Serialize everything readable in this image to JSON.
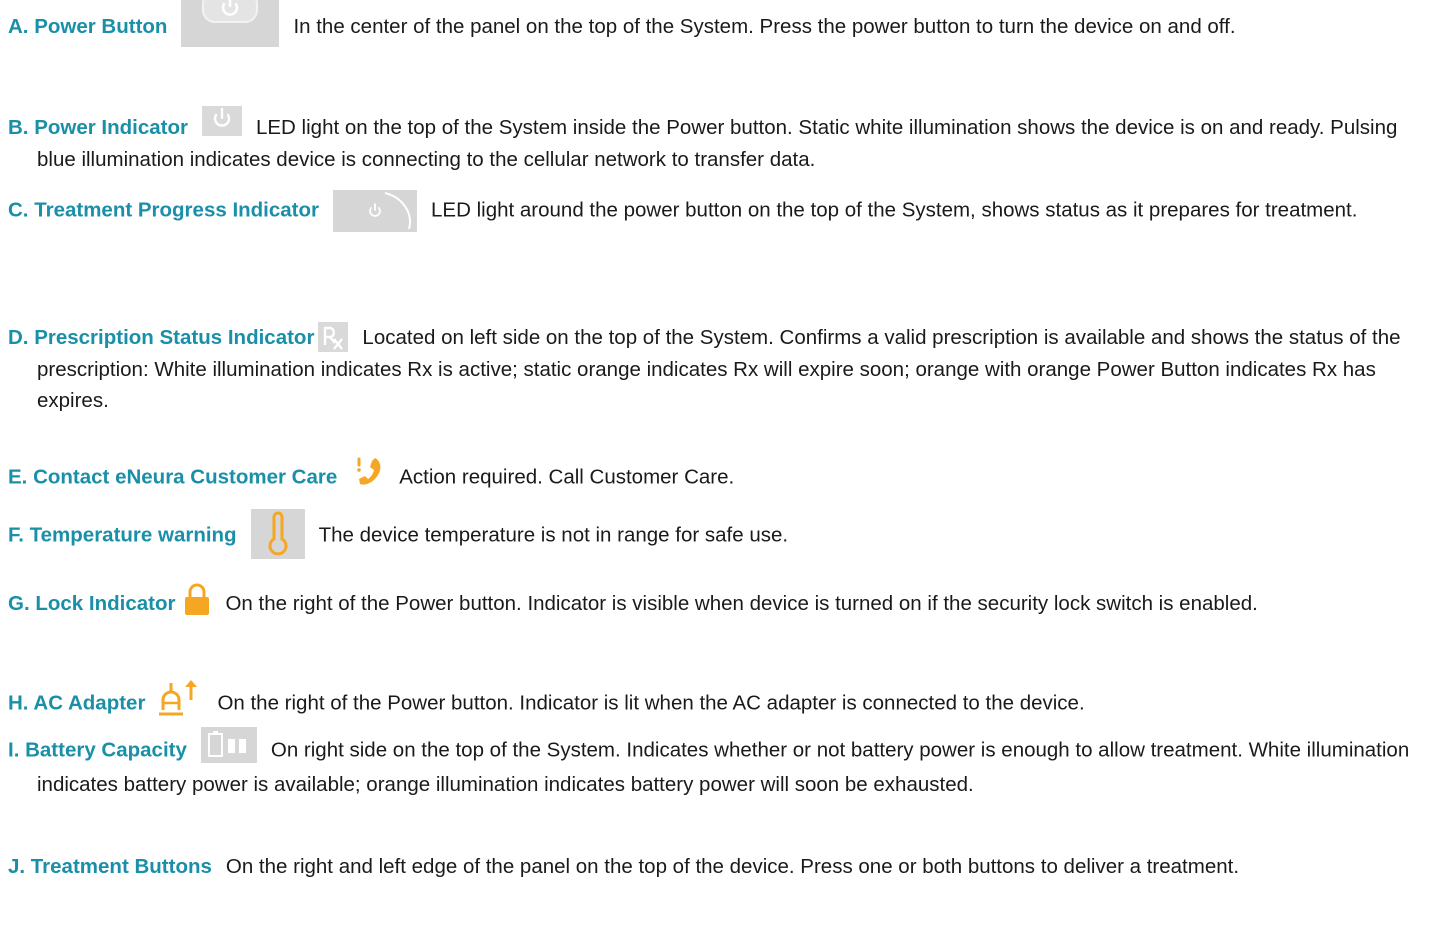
{
  "colors": {
    "term": "#1a8fa8",
    "text": "#1a1a1a",
    "orange": "#f5a623",
    "icon_gray_bg": "#d9d9d9"
  },
  "entries": [
    {
      "term": "A. Power Button",
      "icon": "power-button-icon",
      "description": "In the center of the panel on the top of the System.  Press the power button to turn the device on and off."
    },
    {
      "term": "B. Power Indicator",
      "icon": "power-indicator-icon",
      "description": "LED light on the top of the System inside the Power button.  Static white illumination shows the device is on and ready.  Pulsing blue illumination indicates device is connecting to the cellular network to transfer data."
    },
    {
      "term": "C. Treatment Progress Indicator",
      "icon": "treatment-progress-icon",
      "description": "LED light around the power button on the top of the System, shows status as it prepares for treatment."
    },
    {
      "term": "D. Prescription Status Indicator",
      "icon": "prescription-rx-icon",
      "description": "Located on left side on the top of the System.  Confirms a valid prescription is available and shows the status of the prescription: White illumination indicates Rx is active; static orange indicates Rx will expire soon; orange with orange Power Button indicates Rx has expires."
    },
    {
      "term": "E. Contact eNeura Customer Care",
      "icon": "phone-alert-icon",
      "description": "Action required.  Call Customer Care."
    },
    {
      "term": "F. Temperature warning",
      "icon": "thermometer-icon",
      "description": "The device temperature is not in range for safe use."
    },
    {
      "term": "G. Lock Indicator",
      "icon": "lock-icon",
      "description": "On the right of the Power button.  Indicator is visible when device is turned on if the security lock switch is enabled."
    },
    {
      "term": "H. AC Adapter",
      "icon": "ac-adapter-icon",
      "description": "On the right of the Power button.  Indicator is lit when the AC adapter is connected to the device."
    },
    {
      "term": "I. Battery Capacity",
      "icon": "battery-icon",
      "description": "On right side on the top of the System.  Indicates whether or not battery power is enough to allow treatment. White illumination indicates battery power is available; orange illumination indicates battery power will soon be exhausted."
    },
    {
      "term": "J. Treatment Buttons",
      "icon": "",
      "description": "On the right and left edge of the panel on the top of the device.  Press one or both buttons to deliver a treatment."
    }
  ]
}
